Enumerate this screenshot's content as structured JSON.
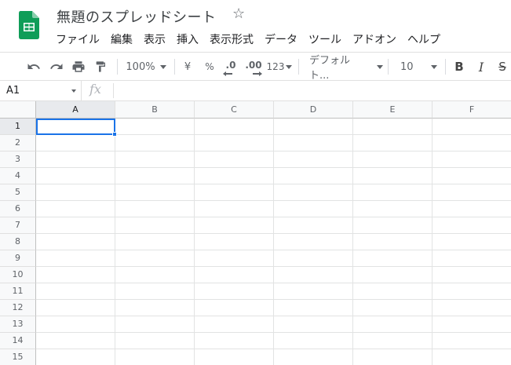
{
  "doc": {
    "title": "無題のスプレッドシート"
  },
  "menu": [
    "ファイル",
    "編集",
    "表示",
    "挿入",
    "表示形式",
    "データ",
    "ツール",
    "アドオン",
    "ヘルプ"
  ],
  "toolbar": {
    "zoom": "100%",
    "currency": "¥",
    "percent": "%",
    "decrease_decimal": ".0",
    "increase_decimal": ".00",
    "more_formats": "123",
    "font": "デフォルト...",
    "font_size": "10",
    "bold": "B",
    "italic": "I",
    "strike": "S"
  },
  "formula_bar": {
    "cell_ref": "A1",
    "fx": "fx",
    "value": ""
  },
  "grid": {
    "columns": [
      "A",
      "B",
      "C",
      "D",
      "E",
      "F"
    ],
    "rows": [
      "1",
      "2",
      "3",
      "4",
      "5",
      "6",
      "7",
      "8",
      "9",
      "10",
      "11",
      "12",
      "13",
      "14",
      "15"
    ],
    "selected_cell": "A1"
  },
  "colors": {
    "accent": "#1a73e8",
    "sheets_green": "#0f9d58"
  },
  "icons": [
    "sheets-logo-icon",
    "star-icon",
    "undo-icon",
    "redo-icon",
    "print-icon",
    "paint-format-icon"
  ]
}
